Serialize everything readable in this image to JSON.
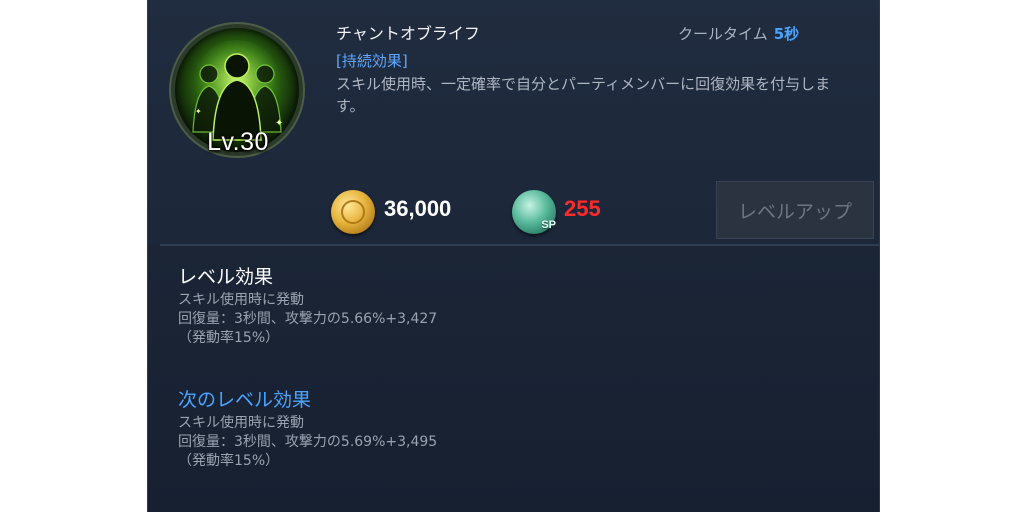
{
  "skill": {
    "name": "チャントオブライフ",
    "level": "Lv.30",
    "cooltime_label": "クールタイム",
    "cooltime_value": "5秒",
    "tag": "[持続効果]",
    "description": "スキル使用時、一定確率で自分とパーティメンバーに回復効果を付与します。",
    "icon": "party-heal-icon"
  },
  "cost": {
    "gold_icon": "gold-coin-icon",
    "gold": "36,000",
    "sp_icon": "sp-token-icon",
    "sp_label": "SP",
    "sp": "255",
    "sp_color": "#ff2a2a"
  },
  "levelup_button": {
    "label": "レベルアップ",
    "enabled": false
  },
  "current_level_effect": {
    "title": "レベル効果",
    "lines": [
      "スキル使用時に発動",
      "回復量：3秒間、攻撃力の5.66%+3,427",
      "（発動率15%）"
    ]
  },
  "next_level_effect": {
    "title": "次のレベル効果",
    "lines": [
      "スキル使用時に発動",
      "回復量：3秒間、攻撃力の5.69%+3,495",
      "（発動率15%）"
    ]
  },
  "colors": {
    "accent_blue": "#4aa3ff",
    "panel_bg": "#1c2739",
    "warning_red": "#ff2a2a"
  }
}
